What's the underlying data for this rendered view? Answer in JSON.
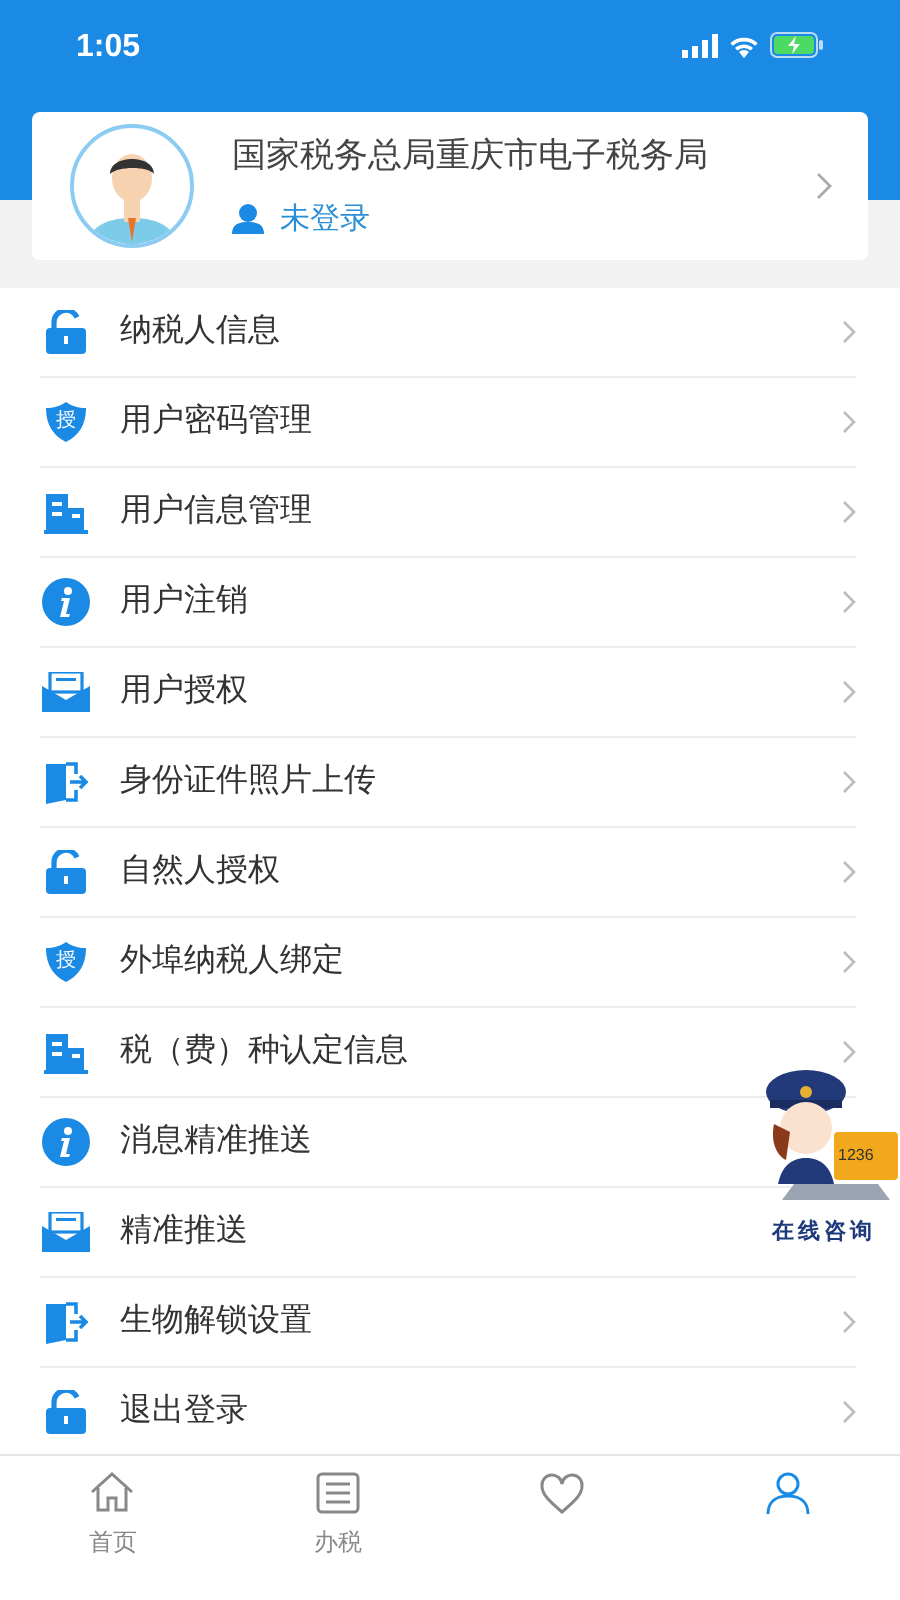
{
  "status_bar": {
    "time": "1:05"
  },
  "profile": {
    "title": "国家税务总局重庆市电子税务局",
    "login_status": "未登录"
  },
  "menu": [
    {
      "label": "纳税人信息"
    },
    {
      "label": "用户密码管理",
      "badge": "授"
    },
    {
      "label": "用户信息管理"
    },
    {
      "label": "用户注销"
    },
    {
      "label": "用户授权"
    },
    {
      "label": "身份证件照片上传"
    },
    {
      "label": "自然人授权"
    },
    {
      "label": "外埠纳税人绑定",
      "badge": "授"
    },
    {
      "label": "税（费）种认定信息"
    },
    {
      "label": "消息精准推送"
    },
    {
      "label": "精准推送"
    },
    {
      "label": "生物解锁设置"
    },
    {
      "label": "退出登录"
    }
  ],
  "consult": {
    "screen_text": "1236",
    "label": "在线咨询"
  },
  "tab_bar": [
    {
      "label": "首页",
      "selected": false
    },
    {
      "label": "办税",
      "selected": false
    },
    {
      "selected": false
    },
    {
      "selected": true
    }
  ]
}
